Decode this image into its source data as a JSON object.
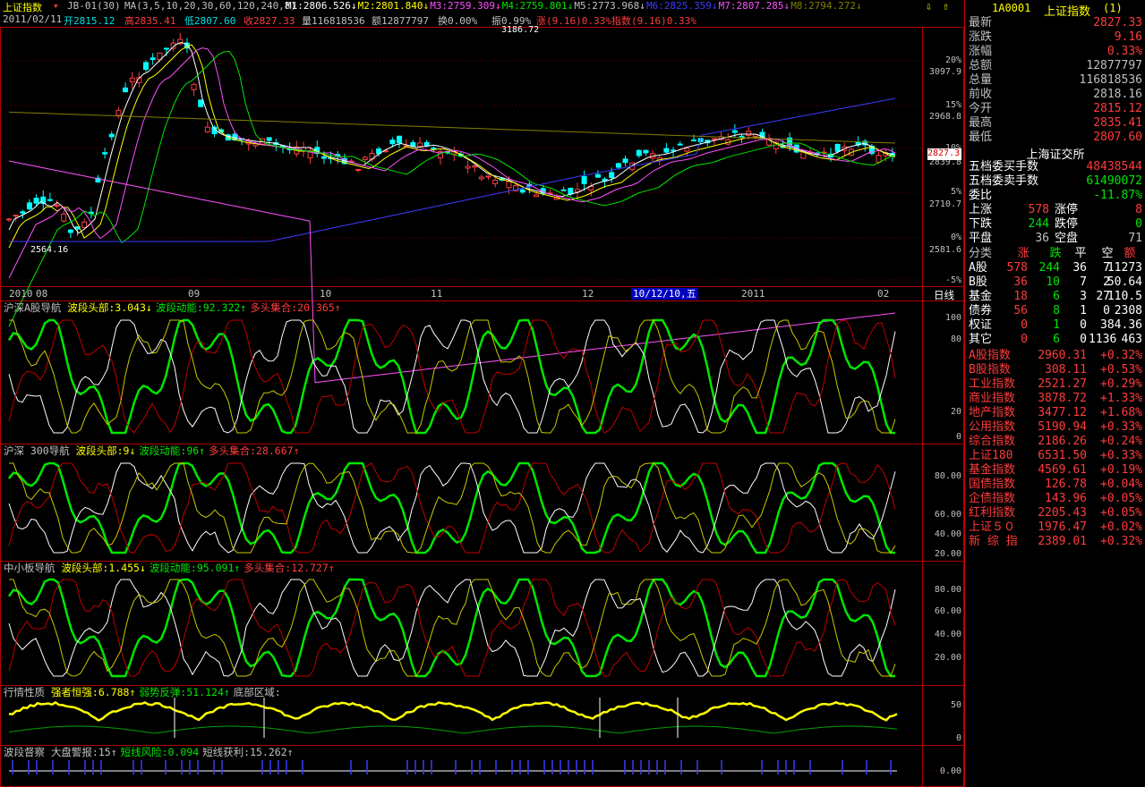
{
  "header": {
    "index_name": "上证指数",
    "indicator": "JB-01(30)",
    "ma_label": "MA(3,5,10,20,30,60,120,240,8)",
    "ma_values": [
      {
        "label": "M1:2806.526",
        "color": "#ffffff"
      },
      {
        "label": "M2:2801.840",
        "color": "#ffff00"
      },
      {
        "label": "M3:2759.309",
        "color": "#ff50ff"
      },
      {
        "label": "M4:2759.801",
        "color": "#00e600"
      },
      {
        "label": "M5:2773.968",
        "color": "#c0c0c0"
      },
      {
        "label": "M6:2825.359",
        "color": "#3c3cff"
      },
      {
        "label": "M7:2807.285",
        "color": "#ff50ff"
      },
      {
        "label": "M8:2794.272",
        "color": "#808000"
      }
    ],
    "date": "2011/02/11",
    "open": "开2815.12",
    "high": "高2835.41",
    "low": "低2807.60",
    "close": "收2827.33",
    "volume": "量116818536",
    "amount": "额12877797",
    "turnover": "换0.00%",
    "amplitude": "振0.99%",
    "change": "涨(9.16)0.33%",
    "index_change": "指数(9.16)0.33%"
  },
  "price_axis": {
    "labels": [
      "20%",
      "3097.9",
      "15%",
      "2968.8",
      "10%",
      "2839.8",
      "5%",
      "2710.7",
      "0%",
      "2581.6",
      "-5%"
    ],
    "current": "2827.3",
    "peak": "3186.72",
    "trough": "2564.16"
  },
  "time_axis": {
    "labels": [
      "2010",
      "08",
      "09",
      "10",
      "11",
      "12",
      "2011",
      "02"
    ],
    "highlight": "10/12/10,五",
    "period_button": "日线"
  },
  "panels": [
    {
      "name": "沪深A股导航",
      "items": [
        {
          "t": "波段头部:3.043↓",
          "c": "#ffff00"
        },
        {
          "t": "波段动能:92.322↑",
          "c": "#00e600"
        },
        {
          "t": "多头集合:20.365↑",
          "c": "#ff3c3c"
        }
      ],
      "axis": [
        "100",
        "80",
        "20",
        "0"
      ]
    },
    {
      "name": "沪深 300导航",
      "items": [
        {
          "t": "波段头部:9↓",
          "c": "#ffff00"
        },
        {
          "t": "波段动能:96↑",
          "c": "#00e600"
        },
        {
          "t": "多头集合:28.667↑",
          "c": "#ff3c3c"
        }
      ],
      "axis": [
        "80.00",
        "60.00",
        "40.00",
        "20.00"
      ]
    },
    {
      "name": "中小板导航",
      "items": [
        {
          "t": "波段头部:1.455↓",
          "c": "#ffff00"
        },
        {
          "t": "波段动能:95.091↑",
          "c": "#00e600"
        },
        {
          "t": "多头集合:12.727↑",
          "c": "#ff3c3c"
        }
      ],
      "axis": [
        "80.00",
        "60.00",
        "40.00",
        "20.00"
      ]
    },
    {
      "name": "行情性质",
      "items": [
        {
          "t": "强者恒强:6.788↑",
          "c": "#ffff00"
        },
        {
          "t": "弱势反弹:51.124↑",
          "c": "#00e600"
        },
        {
          "t": "底部区域:",
          "c": "#c0c0c0"
        }
      ],
      "axis": [
        "50",
        "0"
      ]
    },
    {
      "name": "波段督察",
      "items": [
        {
          "t": "大盘警报:15↑",
          "c": "#c0c0c0"
        },
        {
          "t": "短线风险:0.094",
          "c": "#00e600"
        },
        {
          "t": "短线获利:15.262↑",
          "c": "#c0c0c0"
        }
      ],
      "axis": [
        "0.00"
      ]
    }
  ],
  "quote": {
    "code": "1A0001",
    "name": "上证指数",
    "suffix": "(1)",
    "rows": [
      {
        "k": "最新",
        "v": "2827.33",
        "c": "#ff3c3c"
      },
      {
        "k": "涨跌",
        "v": "9.16",
        "c": "#ff3c3c"
      },
      {
        "k": "涨幅",
        "v": "0.33%",
        "c": "#ff3c3c"
      },
      {
        "k": "总额",
        "v": "12877797",
        "c": "#c0c0c0"
      },
      {
        "k": "总量",
        "v": "116818536",
        "c": "#c0c0c0"
      },
      {
        "k": "前收",
        "v": "2818.16",
        "c": "#c0c0c0"
      },
      {
        "k": "今开",
        "v": "2815.12",
        "c": "#ff3c3c"
      },
      {
        "k": "最高",
        "v": "2835.41",
        "c": "#ff3c3c"
      },
      {
        "k": "最低",
        "v": "2807.60",
        "c": "#ff3c3c"
      }
    ],
    "exchange": "上海证交所",
    "orders": [
      {
        "k": "五档委买手数",
        "v": "48438544",
        "c": "#ff3c3c"
      },
      {
        "k": "五档委卖手数",
        "v": "61490072",
        "c": "#00e600"
      },
      {
        "k": "委比",
        "v": "-11.87%",
        "c": "#00e600"
      }
    ],
    "breadth": [
      {
        "a": "上涨",
        "av": "578",
        "ac": "#ff3c3c",
        "b": "涨停",
        "bv": "8",
        "bc": "#ff3c3c"
      },
      {
        "a": "下跌",
        "av": "244",
        "ac": "#00e600",
        "b": "跌停",
        "bv": "0",
        "bc": "#00e600"
      },
      {
        "a": "平盘",
        "av": "36",
        "ac": "#c0c0c0",
        "b": "空盘",
        "bv": "71",
        "bc": "#c0c0c0"
      }
    ],
    "class_header": [
      "分类",
      "涨",
      "跌",
      "平",
      "空",
      "额"
    ],
    "class_rows": [
      [
        "A股",
        "578",
        "244",
        "36",
        "7",
        "11273"
      ],
      [
        "B股",
        "36",
        "10",
        "7",
        "2",
        "50.64"
      ],
      [
        "基金",
        "18",
        "6",
        "3",
        "27",
        "110.5"
      ],
      [
        "债券",
        "56",
        "8",
        "1",
        "0",
        "2308"
      ],
      [
        "权证",
        "0",
        "1",
        "0",
        "",
        "384.36"
      ],
      [
        "其它",
        "0",
        "6",
        "0",
        "1136",
        "463"
      ]
    ],
    "indices": [
      {
        "k": "A股指数",
        "v": "2960.31",
        "p": "+0.32%"
      },
      {
        "k": "B股指数",
        "v": "308.11",
        "p": "+0.53%"
      },
      {
        "k": "工业指数",
        "v": "2521.27",
        "p": "+0.29%"
      },
      {
        "k": "商业指数",
        "v": "3878.72",
        "p": "+1.33%"
      },
      {
        "k": "地产指数",
        "v": "3477.12",
        "p": "+1.68%"
      },
      {
        "k": "公用指数",
        "v": "5190.94",
        "p": "+0.33%"
      },
      {
        "k": "综合指数",
        "v": "2186.26",
        "p": "+0.24%"
      },
      {
        "k": "上证180",
        "v": "6531.50",
        "p": "+0.33%"
      },
      {
        "k": "基金指数",
        "v": "4569.61",
        "p": "+0.19%"
      },
      {
        "k": "国债指数",
        "v": "126.78",
        "p": "+0.04%"
      },
      {
        "k": "企债指数",
        "v": "143.96",
        "p": "+0.05%"
      },
      {
        "k": "红利指数",
        "v": "2205.43",
        "p": "+0.05%"
      },
      {
        "k": "上证５０",
        "v": "1976.47",
        "p": "+0.02%"
      },
      {
        "k": "新 综 指",
        "v": "2389.01",
        "p": "+0.32%"
      }
    ]
  }
}
